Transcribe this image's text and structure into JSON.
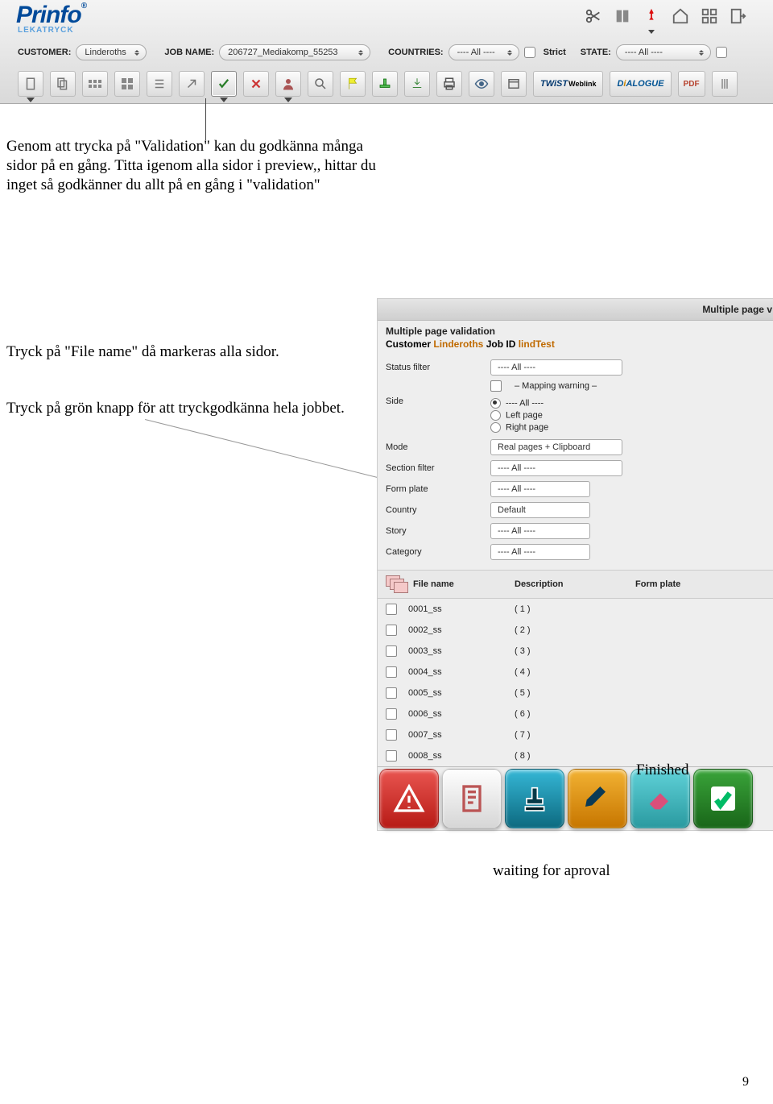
{
  "logo": "Prinfo",
  "logo_sub": "LEKATRYCK",
  "bar1": {
    "customer_lbl": "CUSTOMER:",
    "customer_val": "Linderoths",
    "jobname_lbl": "JOB NAME:",
    "jobname_val": "206727_Mediakomp_55253",
    "countries_lbl": "COUNTRIES:",
    "countries_val": "---- All ----",
    "strict_lbl": "Strict",
    "state_lbl": "STATE:",
    "state_val": "---- All ----"
  },
  "toolbar_text": {
    "twist": "TWiST",
    "twist_sub": "Weblink",
    "dialogue": "DiALOGUE",
    "pdf": "PDF"
  },
  "para1": "Genom att trycka på \"Validation\" kan du godkänna många sidor på en gång. Titta igenom alla sidor i preview,, hittar du inget så godkänner du allt på en gång i \"validation\"",
  "para2": "Tryck på \"File name\" då markeras alla sidor.",
  "para3": "Tryck på grön knapp för att tryckgodkänna hela jobbet.",
  "panel": {
    "head": "Multiple page v",
    "title": "Multiple page validation",
    "cust_lbl": "Customer",
    "cust_val": "Linderoths",
    "job_lbl": "Job ID",
    "job_val": "lindTest",
    "filters": {
      "status_lbl": "Status filter",
      "status_val": "---- All ----",
      "mapping_lbl": "– Mapping warning –",
      "side_lbl": "Side",
      "side_all": "---- All ----",
      "side_left": "Left page",
      "side_right": "Right page",
      "mode_lbl": "Mode",
      "mode_val": "Real pages + Clipboard",
      "section_lbl": "Section filter",
      "section_val": "---- All ----",
      "form_lbl": "Form plate",
      "form_val": "---- All ----",
      "country_lbl": "Country",
      "country_val": "Default",
      "story_lbl": "Story",
      "story_val": "---- All ----",
      "category_lbl": "Category",
      "category_val": "---- All ----"
    },
    "th": {
      "file": "File name",
      "desc": "Description",
      "form": "Form plate"
    },
    "rows": [
      {
        "file": "0001_ss",
        "desc": "( 1 )"
      },
      {
        "file": "0002_ss",
        "desc": "( 2 )"
      },
      {
        "file": "0003_ss",
        "desc": "( 3 )"
      },
      {
        "file": "0004_ss",
        "desc": "( 4 )"
      },
      {
        "file": "0005_ss",
        "desc": "( 5 )"
      },
      {
        "file": "0006_ss",
        "desc": "( 6 )"
      },
      {
        "file": "0007_ss",
        "desc": "( 7 )"
      },
      {
        "file": "0008_ss",
        "desc": "( 8 )"
      }
    ]
  },
  "finished": "Finished",
  "waiting": "waiting for aproval",
  "pageno": "9"
}
